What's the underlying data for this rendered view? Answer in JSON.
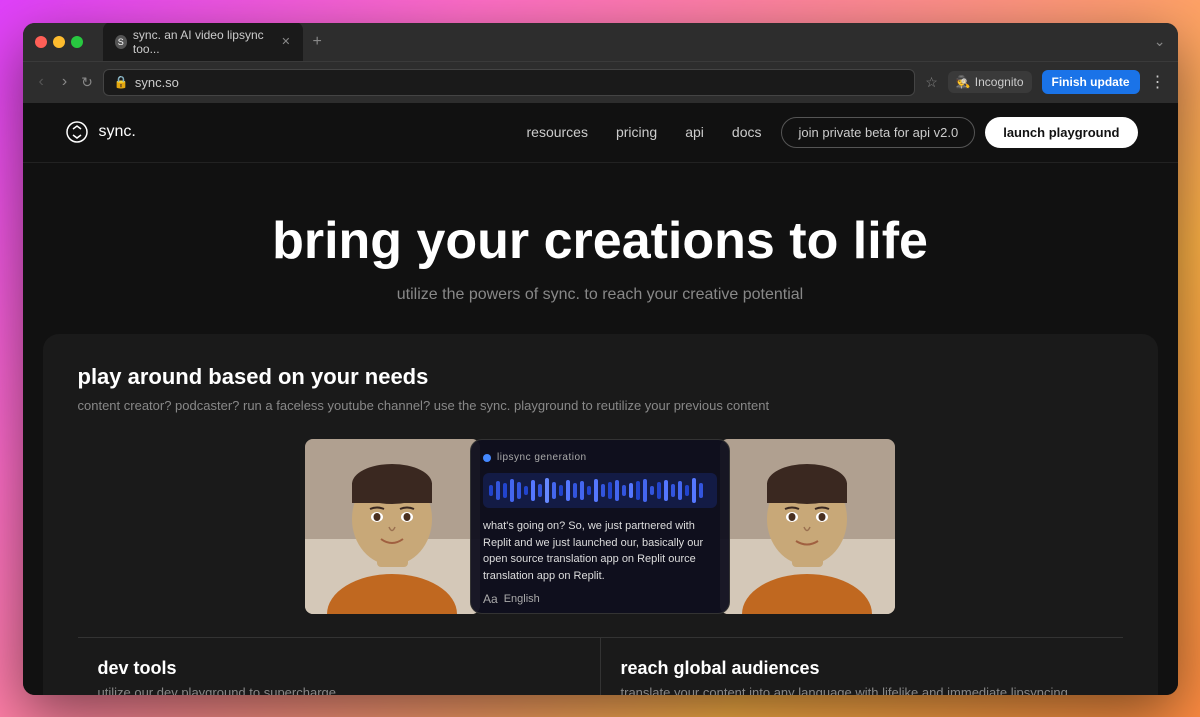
{
  "browser": {
    "tab_title": "sync. an AI video lipsync too...",
    "url": "sync.so",
    "incognito_label": "Incognito",
    "finish_update_label": "Finish update"
  },
  "nav": {
    "logo_text": "sync.",
    "links": [
      {
        "label": "resources"
      },
      {
        "label": "pricing"
      },
      {
        "label": "api"
      },
      {
        "label": "docs"
      }
    ],
    "join_beta_label": "join private beta for api v2.0",
    "launch_playground_label": "launch playground"
  },
  "hero": {
    "title": "bring your creations to life",
    "subtitle": "utilize the powers of sync. to reach your creative potential"
  },
  "section": {
    "title": "play around based on your needs",
    "subtitle": "content creator? podcaster? run a faceless youtube channel? use the sync. playground to reutilize your previous content"
  },
  "lipsync_card": {
    "label": "lipsync generation",
    "text": "what's going on? So, we just partnered with Replit and we just launched our, basically our open source translation app  on Replit ource translation app  on Replit.",
    "language": "English"
  },
  "bottom_cards": [
    {
      "title": "dev tools",
      "desc": "utilize our dev playground to supercharge"
    },
    {
      "title": "reach global audiences",
      "desc": "translate your content into any language with lifelike and immediate lipsyncing."
    }
  ]
}
